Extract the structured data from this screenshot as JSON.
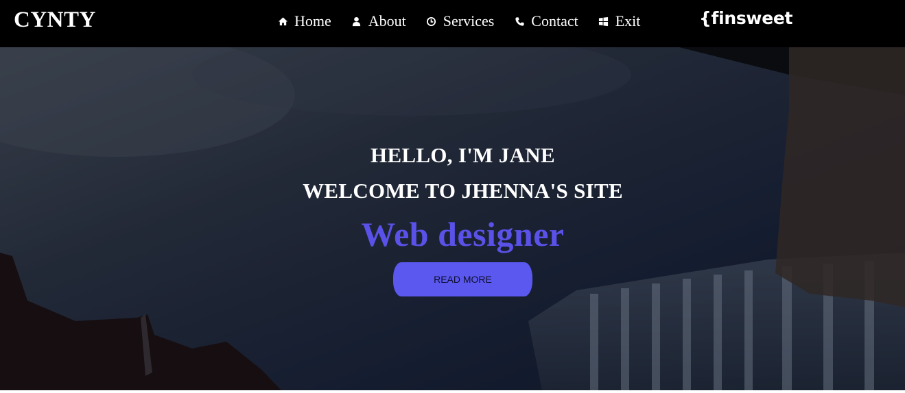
{
  "navbar": {
    "brand": "CYNTY",
    "items": [
      {
        "label": "Home",
        "icon": "home-icon"
      },
      {
        "label": "About",
        "icon": "user-icon"
      },
      {
        "label": "Services",
        "icon": "clock-icon"
      },
      {
        "label": "Contact",
        "icon": "phone-icon"
      },
      {
        "label": "Exit",
        "icon": "windows-icon"
      }
    ],
    "sponsor_logo": "{finsweet"
  },
  "hero": {
    "greeting": "HELLO, I'M JANE",
    "welcome": "WELCOME TO JHENNA'S SITE",
    "role": "Web designer",
    "cta_label": "READ MORE"
  },
  "colors": {
    "navbar_bg": "#000000",
    "accent": "#5a52e8",
    "button_bg": "#5a58ee",
    "hero_bg": "#172033"
  }
}
